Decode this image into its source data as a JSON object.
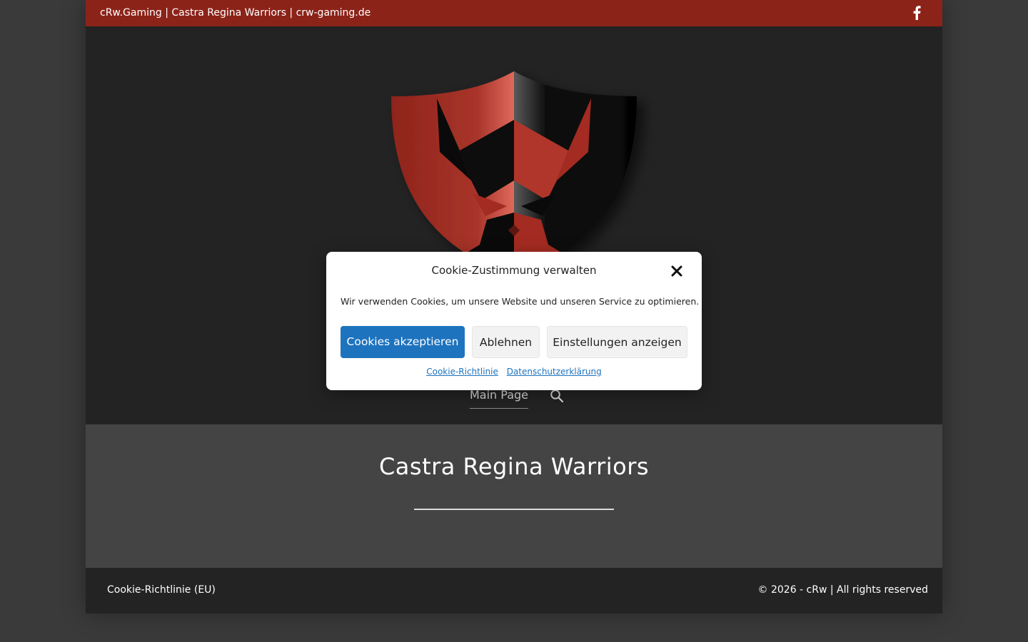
{
  "topbar": {
    "title": "cRw.Gaming | Castra Regina Warriors | crw-gaming.de",
    "social_icon": "facebook-icon"
  },
  "header": {
    "logo": "shield-bull-logo",
    "nav": {
      "main_page_label": "Main Page",
      "search_icon": "search-icon"
    }
  },
  "hero": {
    "title": "Castra Regina Warriors"
  },
  "footer": {
    "left_link": "Cookie-Richtlinie (EU)",
    "copyright": "© 2026 - cRw | All rights reserved"
  },
  "cookie_modal": {
    "title": "Cookie-Zustimmung verwalten",
    "message": "Wir verwenden Cookies, um unsere Website und unseren Service zu optimieren.",
    "accept_label": "Cookies akzeptieren",
    "deny_label": "Ablehnen",
    "settings_label": "Einstellungen anzeigen",
    "link_cookie_policy": "Cookie-Richtlinie",
    "link_privacy": "Datenschutzerklärung"
  },
  "colors": {
    "topbar": "#8c2319",
    "header_bg": "#232323",
    "hero_bg": "#444444",
    "accent_blue": "#1e73be",
    "logo_red": "#9e2a20"
  }
}
